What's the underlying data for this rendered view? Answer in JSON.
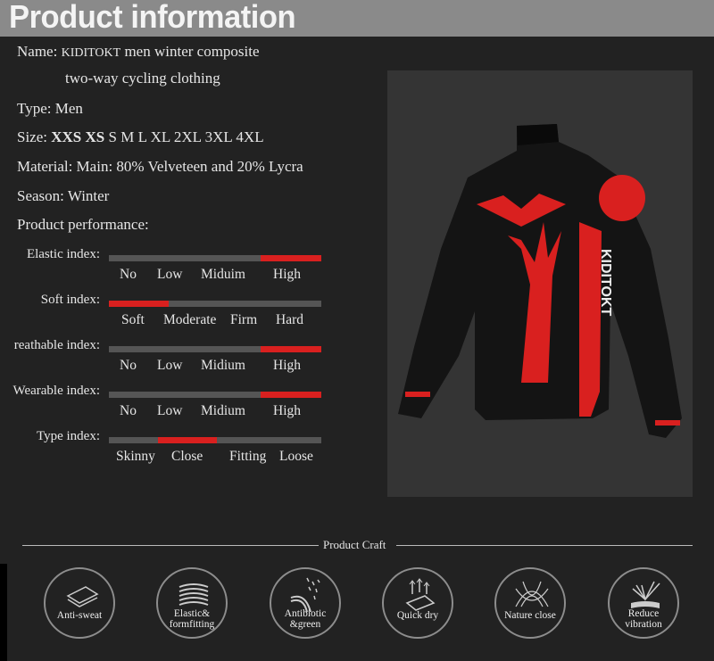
{
  "header": {
    "title": "Product information"
  },
  "info": {
    "name_label": "Name:",
    "brand": "KIDITOKT",
    "name_line1": "men winter composite",
    "name_line2": "two-way cycling clothing",
    "type": "Type: Men",
    "size_label": "Size:",
    "sizes_bold": "XXS XS",
    "sizes": "S M L XL 2XL 3XL 4XL",
    "material": "Material: Main: 80% Velveteen and 20% Lycra",
    "season": "Season: Winter",
    "performance": "Product performance:"
  },
  "indices": [
    {
      "label": "Elastic index:",
      "options": [
        "No",
        "Low",
        "Miduim",
        "High"
      ],
      "selected": "High",
      "fill_start": 0.715,
      "fill_end": 1.0
    },
    {
      "label": "Soft index:",
      "options": [
        "Soft",
        "Moderate",
        "Firm",
        "Hard"
      ],
      "selected": "Soft",
      "fill_start": 0.0,
      "fill_end": 0.28
    },
    {
      "label": "reathable index:",
      "options": [
        "No",
        "Low",
        "Midium",
        "High"
      ],
      "selected": "High",
      "fill_start": 0.715,
      "fill_end": 1.0
    },
    {
      "label": "Wearable index:",
      "options": [
        "No",
        "Low",
        "Midium",
        "High"
      ],
      "selected": "High",
      "fill_start": 0.715,
      "fill_end": 1.0
    },
    {
      "label": "Type index:",
      "options": [
        "Skinny",
        "Close",
        "Fitting",
        "Loose"
      ],
      "selected": "Close",
      "fill_start": 0.23,
      "fill_end": 0.51
    }
  ],
  "product_image": {
    "logo_text": "KIDITOKT",
    "colors": {
      "jersey": "#111111",
      "accent": "#d9201f"
    }
  },
  "craft": {
    "title": "Product Craft",
    "items": [
      {
        "label": "Anti-sweat",
        "icon": "layers-icon"
      },
      {
        "label": "Elastic& formfitting",
        "icon": "waves-icon"
      },
      {
        "label": "Antibiotic &green",
        "icon": "fiber-icon"
      },
      {
        "label": "Quick dry",
        "icon": "evaporate-icon"
      },
      {
        "label": "Nature close",
        "icon": "mesh-icon"
      },
      {
        "label": "Reduce vibration",
        "icon": "shock-icon"
      }
    ]
  },
  "colors": {
    "background": "#222222",
    "header_band": "#8a8a8a",
    "accent": "#d9201f",
    "track": "#555555"
  }
}
